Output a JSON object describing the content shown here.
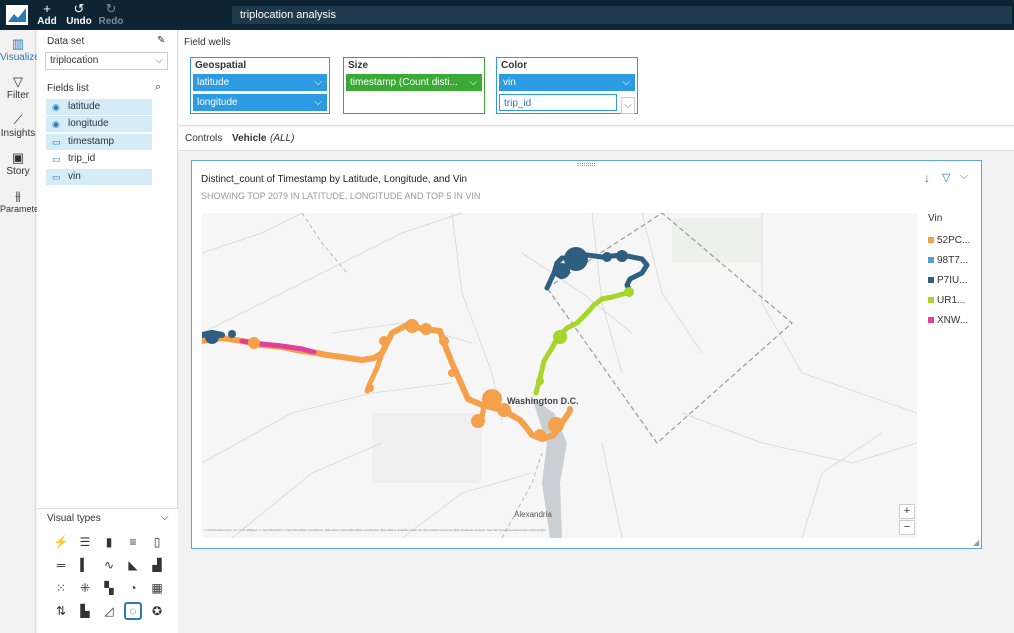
{
  "toolbar": {
    "add": "Add",
    "undo": "Undo",
    "redo": "Redo"
  },
  "analysis_title": "triplocation analysis",
  "nav": [
    "Visualize",
    "Filter",
    "Insights",
    "Story",
    "Parameters"
  ],
  "dataset": {
    "label": "Data set",
    "value": "triplocation"
  },
  "fields": {
    "label": "Fields list",
    "items": [
      "latitude",
      "longitude",
      "timestamp",
      "trip_id",
      "vin"
    ]
  },
  "visual_types": {
    "label": "Visual types"
  },
  "wells": {
    "label": "Field wells",
    "geospatial": {
      "title": "Geospatial",
      "f1": "latitude",
      "f2": "longitude"
    },
    "size": {
      "title": "Size",
      "f1": "timestamp (Count disti..."
    },
    "color": {
      "title": "Color",
      "f1": "vin",
      "f2": "trip_id"
    }
  },
  "controls": {
    "label": "Controls",
    "vehicle": "Vehicle",
    "all": "(ALL)"
  },
  "visual": {
    "title": "Distinct_count of Timestamp by Latitude, Longitude, and Vin",
    "subtitle": "SHOWING TOP 2079 IN LATITUDE, LONGITUDE AND TOP 5 IN VIN",
    "map_label_city": "Washington D.C.",
    "map_label_alex": "Alexandria",
    "attribution": "© 2016 Amazon.com, Inc. or its affiliates. © OpenMapTiles © OpenStreetMap contributors. Map data © OpenStreetMap contributors. Map data is available under the Open Data Commons Open Database License. See http://www.openstreetmap.org/copyright."
  },
  "legend": {
    "title": "Vin",
    "items": [
      {
        "label": "52PC...",
        "color": "#f5a04b"
      },
      {
        "label": "98T7...",
        "color": "#5b9bd5"
      },
      {
        "label": "P7IU...",
        "color": "#2f5f80"
      },
      {
        "label": "UR1...",
        "color": "#a8d52a"
      },
      {
        "label": "XNW...",
        "color": "#e0409a"
      }
    ]
  },
  "colors": {
    "accent": "#2a7ab5",
    "field_blue": "#2d9be3",
    "field_green": "#3aaa35"
  }
}
